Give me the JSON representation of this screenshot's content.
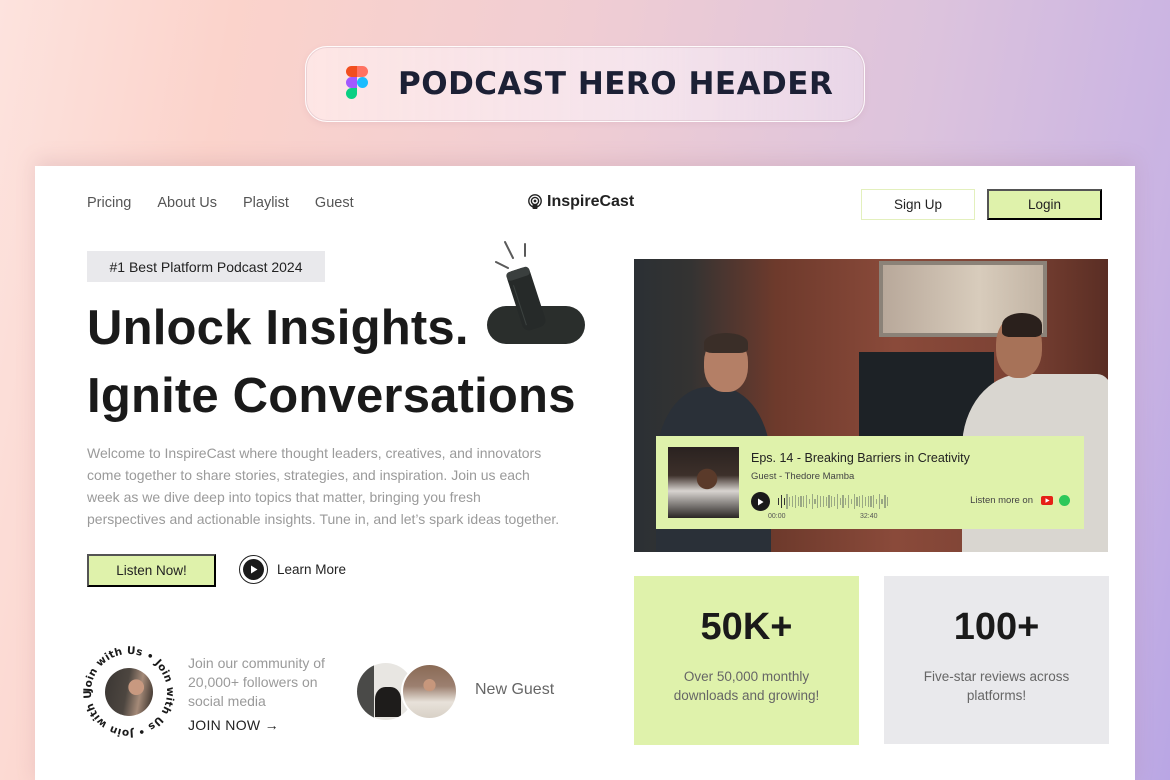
{
  "banner": {
    "icon": "figma-icon",
    "title": "PODCAST HERO HEADER"
  },
  "nav": {
    "links": [
      "Pricing",
      "About Us",
      "Playlist",
      "Guest"
    ],
    "brand": "InspireCast",
    "brand_icon": "podcast-icon",
    "signup_label": "Sign Up",
    "login_label": "Login"
  },
  "hero": {
    "badge": "#1 Best Platform Podcast 2024",
    "headline_line1": "Unlock Insights.",
    "headline_line2": "Ignite Conversations",
    "description": "Welcome to InspireCast where thought leaders, creatives, and innovators come together to share stories, strategies, and inspiration. Join us each week as we dive deep into topics that matter, bringing you fresh perspectives and actionable insights. Tune in, and let’s spark ideas together.",
    "listen_label": "Listen Now!",
    "learn_more_label": "Learn More"
  },
  "community": {
    "badge_text": "Join with Us • Join with Us • Join with Us • ",
    "text": "Join our community of 20,000+ followers on social media",
    "cta": "JOIN NOW →",
    "guest_label": "New Guest"
  },
  "player": {
    "episode_title": "Eps. 14 - Breaking Barriers in Creativity",
    "guest": "Guest - Thedore Mamba",
    "time_current": "00:00",
    "time_total": "32:40",
    "progress": 0.08,
    "listen_more": "Listen more on",
    "platforms": [
      "youtube-icon",
      "spotify-icon"
    ]
  },
  "stats": [
    {
      "value": "50K+",
      "description": "Over 50,000 monthly downloads and growing!"
    },
    {
      "value": "100+",
      "description": "Five-star reviews across platforms!"
    }
  ],
  "colors": {
    "accent": "#dff2ab",
    "muted_card": "#e9e9ec",
    "text_dark": "#1a1a1a",
    "banner_text": "#1c2035"
  }
}
